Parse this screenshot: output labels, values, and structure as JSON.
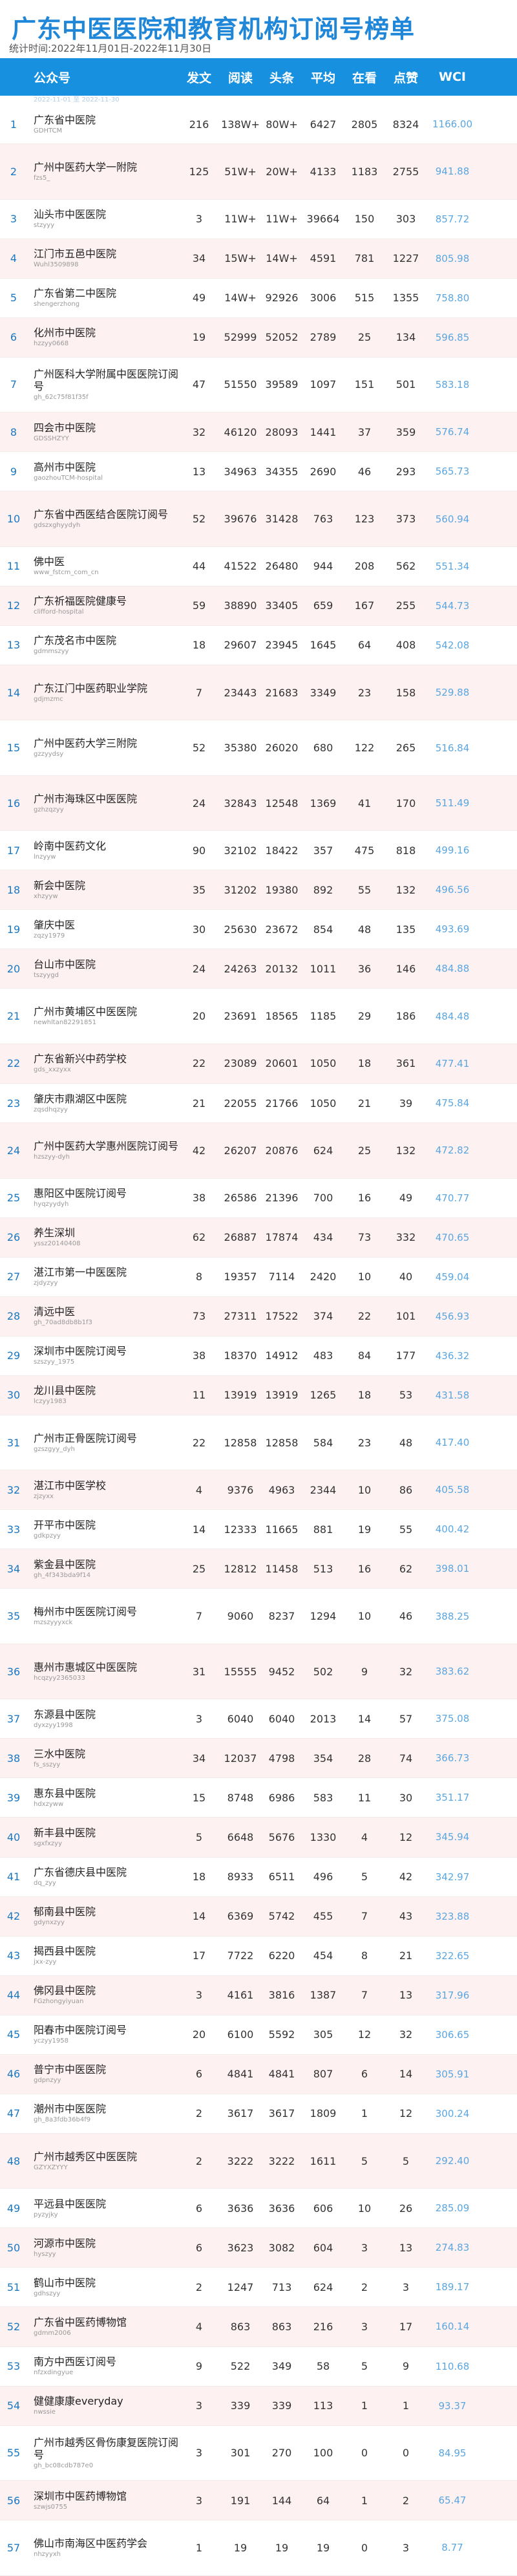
{
  "title": "广东中医医院和教育机构订阅号榜单",
  "subtitle": "统计时间:2022年11月01日-2022年11月30日",
  "header": {
    "account": "公众号",
    "posts": "发文",
    "reads": "阅读",
    "headline": "头条",
    "avg": "平均",
    "likes": "在看",
    "zan": "点赞",
    "wci": "WCI"
  },
  "header_sub": "2022-11-01 至 2022-11-30",
  "rows": [
    {
      "rank": "1",
      "name": "广东省中医院",
      "id": "GDHTCM",
      "posts": "216",
      "reads": "138W+",
      "head": "80W+",
      "avg": "6427",
      "look": "2805",
      "zan": "8324",
      "wci": "1166.00"
    },
    {
      "rank": "2",
      "name": "广州中医药大学一附院",
      "id": "fzs5_",
      "posts": "125",
      "reads": "51W+",
      "head": "20W+",
      "avg": "4133",
      "look": "1183",
      "zan": "2755",
      "wci": "941.88"
    },
    {
      "rank": "3",
      "name": "汕头市中医医院",
      "id": "stzyyy",
      "posts": "3",
      "reads": "11W+",
      "head": "11W+",
      "avg": "39664",
      "look": "150",
      "zan": "303",
      "wci": "857.72"
    },
    {
      "rank": "4",
      "name": "江门市五邑中医院",
      "id": "Wuhl3509898",
      "posts": "34",
      "reads": "15W+",
      "head": "14W+",
      "avg": "4591",
      "look": "781",
      "zan": "1227",
      "wci": "805.98"
    },
    {
      "rank": "5",
      "name": "广东省第二中医院",
      "id": "shengerzhong",
      "posts": "49",
      "reads": "14W+",
      "head": "92926",
      "avg": "3006",
      "look": "515",
      "zan": "1355",
      "wci": "758.80"
    },
    {
      "rank": "6",
      "name": "化州市中医院",
      "id": "hzzyy0668",
      "posts": "19",
      "reads": "52999",
      "head": "52052",
      "avg": "2789",
      "look": "25",
      "zan": "134",
      "wci": "596.85"
    },
    {
      "rank": "7",
      "name": "广州医科大学附属中医医院订阅号",
      "id": "gh_62c75f81f35f",
      "posts": "47",
      "reads": "51550",
      "head": "39589",
      "avg": "1097",
      "look": "151",
      "zan": "501",
      "wci": "583.18"
    },
    {
      "rank": "8",
      "name": "四会市中医院",
      "id": "GDSSHZYY",
      "posts": "32",
      "reads": "46120",
      "head": "28093",
      "avg": "1441",
      "look": "37",
      "zan": "359",
      "wci": "576.74"
    },
    {
      "rank": "9",
      "name": "高州市中医院",
      "id": "gaozhouTCM-hospital",
      "posts": "13",
      "reads": "34963",
      "head": "34355",
      "avg": "2690",
      "look": "46",
      "zan": "293",
      "wci": "565.73"
    },
    {
      "rank": "10",
      "name": "广东省中西医结合医院订阅号",
      "id": "gdszxghyydyh",
      "posts": "52",
      "reads": "39676",
      "head": "31428",
      "avg": "763",
      "look": "123",
      "zan": "373",
      "wci": "560.94"
    },
    {
      "rank": "11",
      "name": "佛中医",
      "id": "www_fstcm_com_cn",
      "posts": "44",
      "reads": "41522",
      "head": "26480",
      "avg": "944",
      "look": "208",
      "zan": "562",
      "wci": "551.34"
    },
    {
      "rank": "12",
      "name": "广东祈福医院健康号",
      "id": "clifford-hospital",
      "posts": "59",
      "reads": "38890",
      "head": "33405",
      "avg": "659",
      "look": "167",
      "zan": "255",
      "wci": "544.73"
    },
    {
      "rank": "13",
      "name": "广东茂名市中医院",
      "id": "gdmmszyy",
      "posts": "18",
      "reads": "29607",
      "head": "23945",
      "avg": "1645",
      "look": "64",
      "zan": "408",
      "wci": "542.08"
    },
    {
      "rank": "14",
      "name": "广东江门中医药职业学院",
      "id": "gdjmzmc",
      "posts": "7",
      "reads": "23443",
      "head": "21683",
      "avg": "3349",
      "look": "23",
      "zan": "158",
      "wci": "529.88"
    },
    {
      "rank": "15",
      "name": "广州中医药大学三附院",
      "id": "gzzyydsy",
      "posts": "52",
      "reads": "35380",
      "head": "26020",
      "avg": "680",
      "look": "122",
      "zan": "265",
      "wci": "516.84"
    },
    {
      "rank": "16",
      "name": "广州市海珠区中医医院",
      "id": "gzhzqzyy",
      "posts": "24",
      "reads": "32843",
      "head": "12548",
      "avg": "1369",
      "look": "41",
      "zan": "170",
      "wci": "511.49"
    },
    {
      "rank": "17",
      "name": "岭南中医药文化",
      "id": "lnzyyw",
      "posts": "90",
      "reads": "32102",
      "head": "18422",
      "avg": "357",
      "look": "475",
      "zan": "818",
      "wci": "499.16"
    },
    {
      "rank": "18",
      "name": "新会中医院",
      "id": "xhzyyw",
      "posts": "35",
      "reads": "31202",
      "head": "19380",
      "avg": "892",
      "look": "55",
      "zan": "132",
      "wci": "496.56"
    },
    {
      "rank": "19",
      "name": "肇庆中医",
      "id": "zqzy1979",
      "posts": "30",
      "reads": "25630",
      "head": "23672",
      "avg": "854",
      "look": "48",
      "zan": "135",
      "wci": "493.69"
    },
    {
      "rank": "20",
      "name": "台山市中医院",
      "id": "tszyygd",
      "posts": "24",
      "reads": "24263",
      "head": "20132",
      "avg": "1011",
      "look": "36",
      "zan": "146",
      "wci": "484.88"
    },
    {
      "rank": "21",
      "name": "广州市黄埔区中医医院",
      "id": "newhltan82291851",
      "posts": "20",
      "reads": "23691",
      "head": "18565",
      "avg": "1185",
      "look": "29",
      "zan": "186",
      "wci": "484.48"
    },
    {
      "rank": "22",
      "name": "广东省新兴中药学校",
      "id": "gds_xxzyxx",
      "posts": "22",
      "reads": "23089",
      "head": "20601",
      "avg": "1050",
      "look": "18",
      "zan": "361",
      "wci": "477.41"
    },
    {
      "rank": "23",
      "name": "肇庆市鼎湖区中医院",
      "id": "zqsdhqzyy",
      "posts": "21",
      "reads": "22055",
      "head": "21766",
      "avg": "1050",
      "look": "21",
      "zan": "39",
      "wci": "475.84"
    },
    {
      "rank": "24",
      "name": "广州中医药大学惠州医院订阅号",
      "id": "hzszyy-dyh",
      "posts": "42",
      "reads": "26207",
      "head": "20876",
      "avg": "624",
      "look": "25",
      "zan": "132",
      "wci": "472.82"
    },
    {
      "rank": "25",
      "name": "惠阳区中医院订阅号",
      "id": "hyqzyydyh",
      "posts": "38",
      "reads": "26586",
      "head": "21396",
      "avg": "700",
      "look": "16",
      "zan": "49",
      "wci": "470.77"
    },
    {
      "rank": "26",
      "name": "养生深圳",
      "id": "yssz20140408",
      "posts": "62",
      "reads": "26887",
      "head": "17874",
      "avg": "434",
      "look": "73",
      "zan": "332",
      "wci": "470.65"
    },
    {
      "rank": "27",
      "name": "湛江市第一中医医院",
      "id": "zjdyzyy",
      "posts": "8",
      "reads": "19357",
      "head": "7114",
      "avg": "2420",
      "look": "10",
      "zan": "40",
      "wci": "459.04"
    },
    {
      "rank": "28",
      "name": "清远中医",
      "id": "gh_70ad8db8b1f3",
      "posts": "73",
      "reads": "27311",
      "head": "17522",
      "avg": "374",
      "look": "22",
      "zan": "101",
      "wci": "456.93"
    },
    {
      "rank": "29",
      "name": "深圳市中医院订阅号",
      "id": "szszyy_1975",
      "posts": "38",
      "reads": "18370",
      "head": "14912",
      "avg": "483",
      "look": "84",
      "zan": "177",
      "wci": "436.32"
    },
    {
      "rank": "30",
      "name": "龙川县中医院",
      "id": "lczyy1983",
      "posts": "11",
      "reads": "13919",
      "head": "13919",
      "avg": "1265",
      "look": "18",
      "zan": "53",
      "wci": "431.58"
    },
    {
      "rank": "31",
      "name": "广州市正骨医院订阅号",
      "id": "gzszgyy_dyh",
      "posts": "22",
      "reads": "12858",
      "head": "12858",
      "avg": "584",
      "look": "23",
      "zan": "48",
      "wci": "417.40"
    },
    {
      "rank": "32",
      "name": "湛江市中医学校",
      "id": "zjzyxx",
      "posts": "4",
      "reads": "9376",
      "head": "4963",
      "avg": "2344",
      "look": "10",
      "zan": "86",
      "wci": "405.58"
    },
    {
      "rank": "33",
      "name": "开平市中医院",
      "id": "gdkpzyy",
      "posts": "14",
      "reads": "12333",
      "head": "11665",
      "avg": "881",
      "look": "19",
      "zan": "55",
      "wci": "400.42"
    },
    {
      "rank": "34",
      "name": "紫金县中医院",
      "id": "gh_4f343bda9f14",
      "posts": "25",
      "reads": "12812",
      "head": "11458",
      "avg": "513",
      "look": "16",
      "zan": "62",
      "wci": "398.01"
    },
    {
      "rank": "35",
      "name": "梅州市中医医院订阅号",
      "id": "mzszyyyxck",
      "posts": "7",
      "reads": "9060",
      "head": "8237",
      "avg": "1294",
      "look": "10",
      "zan": "46",
      "wci": "388.25"
    },
    {
      "rank": "36",
      "name": "惠州市惠城区中医医院",
      "id": "hcqzyy2365033",
      "posts": "31",
      "reads": "15555",
      "head": "9452",
      "avg": "502",
      "look": "9",
      "zan": "32",
      "wci": "383.62"
    },
    {
      "rank": "37",
      "name": "东源县中医院",
      "id": "dyxzyy1998",
      "posts": "3",
      "reads": "6040",
      "head": "6040",
      "avg": "2013",
      "look": "14",
      "zan": "57",
      "wci": "375.08"
    },
    {
      "rank": "38",
      "name": "三水中医院",
      "id": "fs_sszyy",
      "posts": "34",
      "reads": "12037",
      "head": "4798",
      "avg": "354",
      "look": "28",
      "zan": "74",
      "wci": "366.73"
    },
    {
      "rank": "39",
      "name": "惠东县中医院",
      "id": "hdxzyww",
      "posts": "15",
      "reads": "8748",
      "head": "6986",
      "avg": "583",
      "look": "11",
      "zan": "30",
      "wci": "351.17"
    },
    {
      "rank": "40",
      "name": "新丰县中医院",
      "id": "sgxfxzyy",
      "posts": "5",
      "reads": "6648",
      "head": "5676",
      "avg": "1330",
      "look": "4",
      "zan": "12",
      "wci": "345.94"
    },
    {
      "rank": "41",
      "name": "广东省德庆县中医院",
      "id": "dq_zyy",
      "posts": "18",
      "reads": "8933",
      "head": "6511",
      "avg": "496",
      "look": "5",
      "zan": "42",
      "wci": "342.97"
    },
    {
      "rank": "42",
      "name": "郁南县中医院",
      "id": "gdynxzyy",
      "posts": "14",
      "reads": "6369",
      "head": "5742",
      "avg": "455",
      "look": "7",
      "zan": "43",
      "wci": "323.88"
    },
    {
      "rank": "43",
      "name": "揭西县中医院",
      "id": "jxx-zyy",
      "posts": "17",
      "reads": "7722",
      "head": "6220",
      "avg": "454",
      "look": "8",
      "zan": "21",
      "wci": "322.65"
    },
    {
      "rank": "44",
      "name": "佛冈县中医院",
      "id": "FGzhongyiyuan",
      "posts": "3",
      "reads": "4161",
      "head": "3816",
      "avg": "1387",
      "look": "7",
      "zan": "13",
      "wci": "317.96"
    },
    {
      "rank": "45",
      "name": "阳春市中医院订阅号",
      "id": "yczyy1958",
      "posts": "20",
      "reads": "6100",
      "head": "5592",
      "avg": "305",
      "look": "12",
      "zan": "32",
      "wci": "306.65"
    },
    {
      "rank": "46",
      "name": "普宁市中医医院",
      "id": "gdpnzyy",
      "posts": "6",
      "reads": "4841",
      "head": "4841",
      "avg": "807",
      "look": "6",
      "zan": "14",
      "wci": "305.91"
    },
    {
      "rank": "47",
      "name": "潮州市中医医院",
      "id": "gh_8a3fdb36b4f9",
      "posts": "2",
      "reads": "3617",
      "head": "3617",
      "avg": "1809",
      "look": "1",
      "zan": "12",
      "wci": "300.24"
    },
    {
      "rank": "48",
      "name": "广州市越秀区中医医院",
      "id": "GZYXZYYY",
      "posts": "2",
      "reads": "3222",
      "head": "3222",
      "avg": "1611",
      "look": "5",
      "zan": "5",
      "wci": "292.40"
    },
    {
      "rank": "49",
      "name": "平远县中医医院",
      "id": "pyzyjky",
      "posts": "6",
      "reads": "3636",
      "head": "3636",
      "avg": "606",
      "look": "10",
      "zan": "26",
      "wci": "285.09"
    },
    {
      "rank": "50",
      "name": "河源市中医院",
      "id": "hyszyy",
      "posts": "6",
      "reads": "3623",
      "head": "3082",
      "avg": "604",
      "look": "3",
      "zan": "13",
      "wci": "274.83"
    },
    {
      "rank": "51",
      "name": "鹤山市中医院",
      "id": "gdhszyy",
      "posts": "2",
      "reads": "1247",
      "head": "713",
      "avg": "624",
      "look": "2",
      "zan": "3",
      "wci": "189.17"
    },
    {
      "rank": "52",
      "name": "广东省中医药博物馆",
      "id": "gdmm2006",
      "posts": "4",
      "reads": "863",
      "head": "863",
      "avg": "216",
      "look": "3",
      "zan": "17",
      "wci": "160.14"
    },
    {
      "rank": "53",
      "name": "南方中西医订阅号",
      "id": "nfzxdingyue",
      "posts": "9",
      "reads": "522",
      "head": "349",
      "avg": "58",
      "look": "5",
      "zan": "9",
      "wci": "110.68"
    },
    {
      "rank": "54",
      "name": "健健康康everyday",
      "id": "nwssie",
      "posts": "3",
      "reads": "339",
      "head": "339",
      "avg": "113",
      "look": "1",
      "zan": "1",
      "wci": "93.37"
    },
    {
      "rank": "55",
      "name": "广州市越秀区骨伤康复医院订阅号",
      "id": "gh_bc08cdb787e0",
      "posts": "3",
      "reads": "301",
      "head": "270",
      "avg": "100",
      "look": "0",
      "zan": "0",
      "wci": "84.95"
    },
    {
      "rank": "56",
      "name": "深圳市中医药博物馆",
      "id": "szwjs0755",
      "posts": "3",
      "reads": "191",
      "head": "144",
      "avg": "64",
      "look": "1",
      "zan": "2",
      "wci": "65.47"
    },
    {
      "rank": "57",
      "name": "佛山市南海区中医药学会",
      "id": "nhzyyxh",
      "posts": "1",
      "reads": "19",
      "head": "19",
      "avg": "19",
      "look": "0",
      "zan": "3",
      "wci": "8.77"
    }
  ]
}
